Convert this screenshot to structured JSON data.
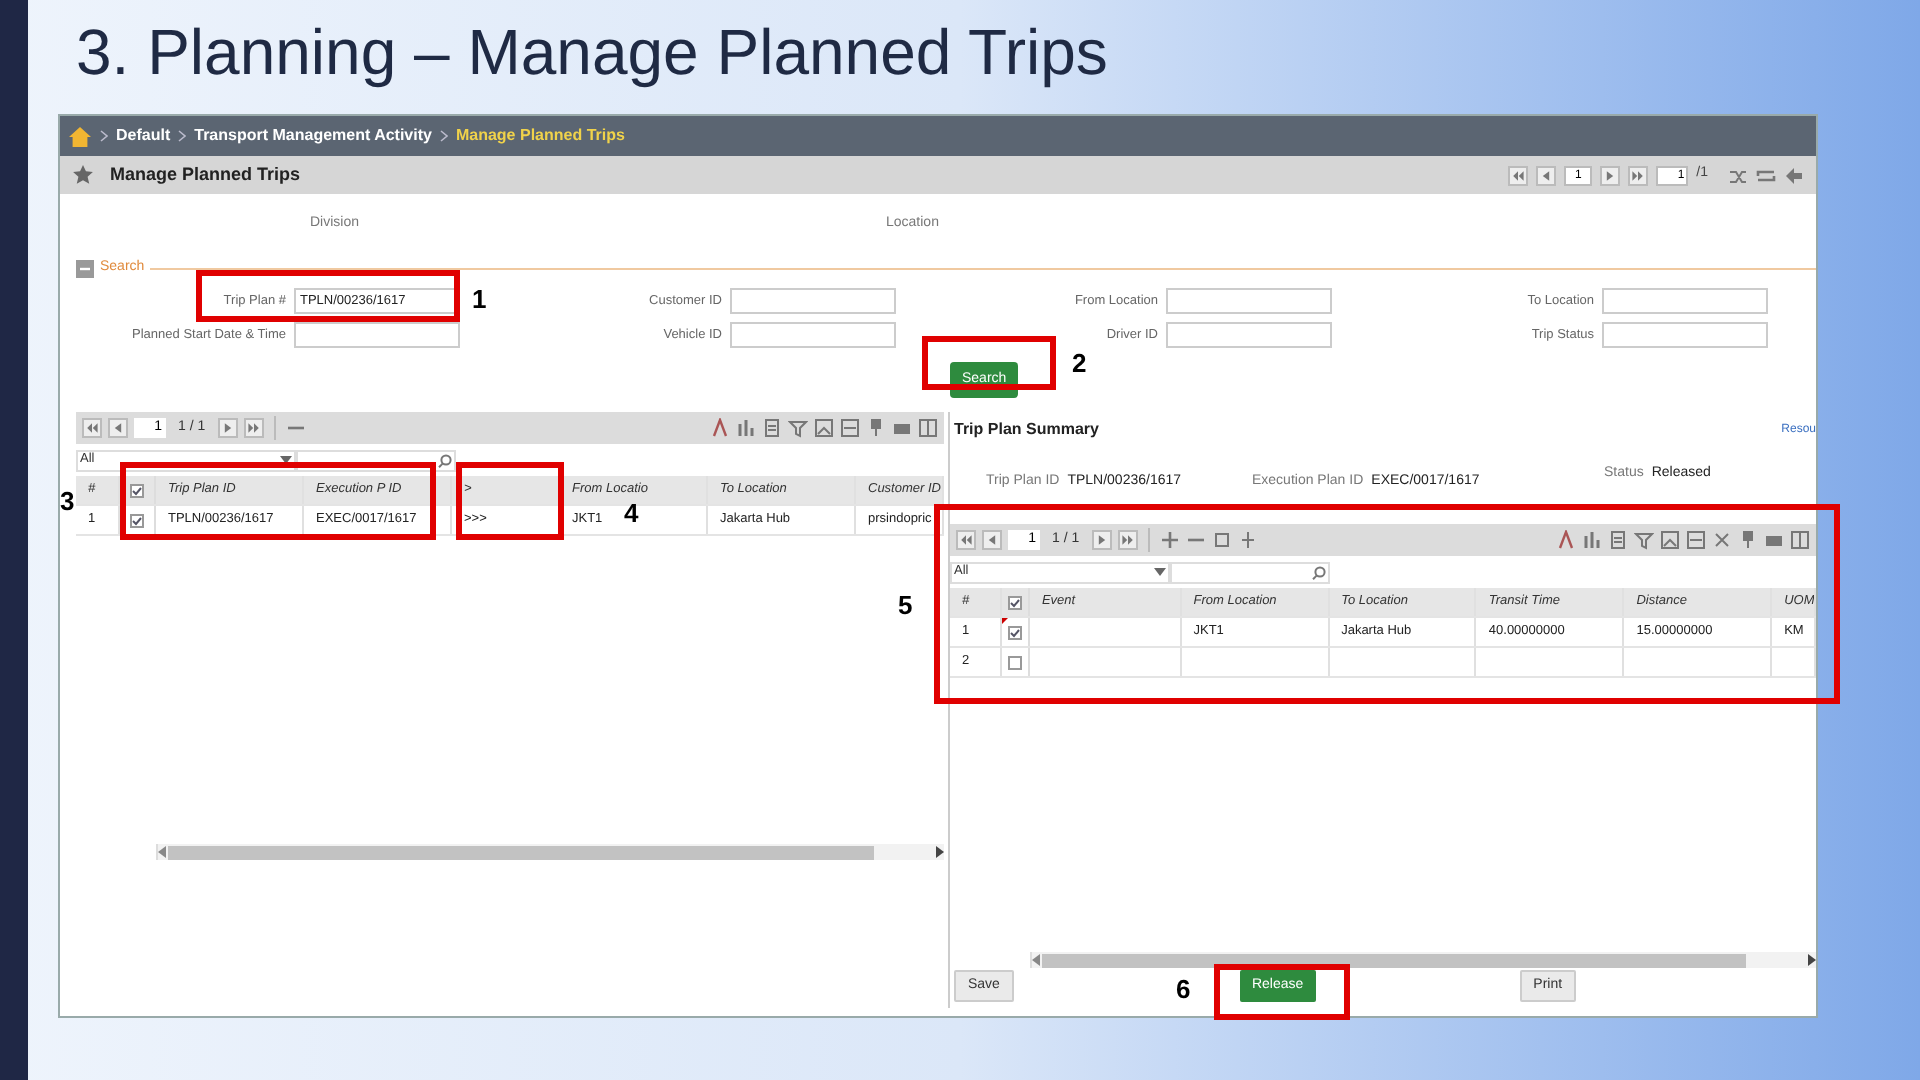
{
  "slide_title": "3. Planning – Manage Planned Trips",
  "breadcrumb": [
    {
      "label": "Default",
      "current": false
    },
    {
      "label": "Transport Management Activity",
      "current": false
    },
    {
      "label": "Manage Planned Trips",
      "current": true
    }
  ],
  "page_title": "Manage Planned Trips",
  "pager": {
    "page": "1",
    "jump": "1",
    "total": "/1"
  },
  "filter_labels": [
    "Division",
    "Location"
  ],
  "search": {
    "title": "Search",
    "expanded": true,
    "button": "Search",
    "fields": [
      {
        "label": "Trip Plan #",
        "value": "TPLN/00236/1617"
      },
      {
        "label": "Customer ID"
      },
      {
        "label": "From Location"
      },
      {
        "label": "To Location"
      },
      {
        "label": "Planned Start Date & Time"
      },
      {
        "label": "Vehicle ID"
      },
      {
        "label": "Driver ID"
      },
      {
        "label": "Trip Status"
      }
    ]
  },
  "trip_grid": {
    "page": "1",
    "page_count": "1 / 1",
    "filter": "All",
    "header_checked": true,
    "columns": [
      "#",
      "Trip Plan ID",
      "Execution P ID",
      ">",
      "From Locatio",
      "To Location",
      "Customer ID"
    ],
    "rows": [
      {
        "number": "1",
        "checked": true,
        "modified": false,
        "trip_plan_id": "TPLN/00236/1617",
        "execution_plan_id": "EXEC/0017/1617",
        "link": ">>>",
        "from_location": "JKT1",
        "to_location": "Jakarta Hub",
        "customer_id": "prsindopric"
      }
    ]
  },
  "summary": {
    "title": "Trip Plan Summary",
    "link": "Resou",
    "fields": [
      {
        "label": "Trip Plan ID",
        "value": "TPLN/00236/1617"
      },
      {
        "label": "Execution Plan ID",
        "value": "EXEC/0017/1617"
      },
      {
        "label": "Status",
        "value": "Released"
      }
    ]
  },
  "event_grid": {
    "page": "1",
    "page_count": "1 / 1",
    "filter": "All",
    "header_checked": true,
    "columns": [
      "#",
      "Event",
      "From Location",
      "To Location",
      "Transit Time",
      "Distance",
      "UOM"
    ],
    "rows": [
      {
        "number": "1",
        "checked": true,
        "modified": true,
        "from_location": "JKT1",
        "to_location": "Jakarta Hub",
        "transit_time": "40.00000000",
        "distance": "15.00000000",
        "uom": "KM"
      },
      {
        "number": "2",
        "checked": false,
        "modified": false
      }
    ]
  },
  "buttons": [
    {
      "label": "Save",
      "kind": "plain"
    },
    {
      "label": "Release",
      "kind": "primary"
    },
    {
      "label": "Print",
      "kind": "plain"
    }
  ],
  "annotations": [
    {
      "number": "1"
    },
    {
      "number": "2"
    },
    {
      "number": "3"
    },
    {
      "number": "4"
    },
    {
      "number": "5"
    },
    {
      "number": "6"
    }
  ]
}
